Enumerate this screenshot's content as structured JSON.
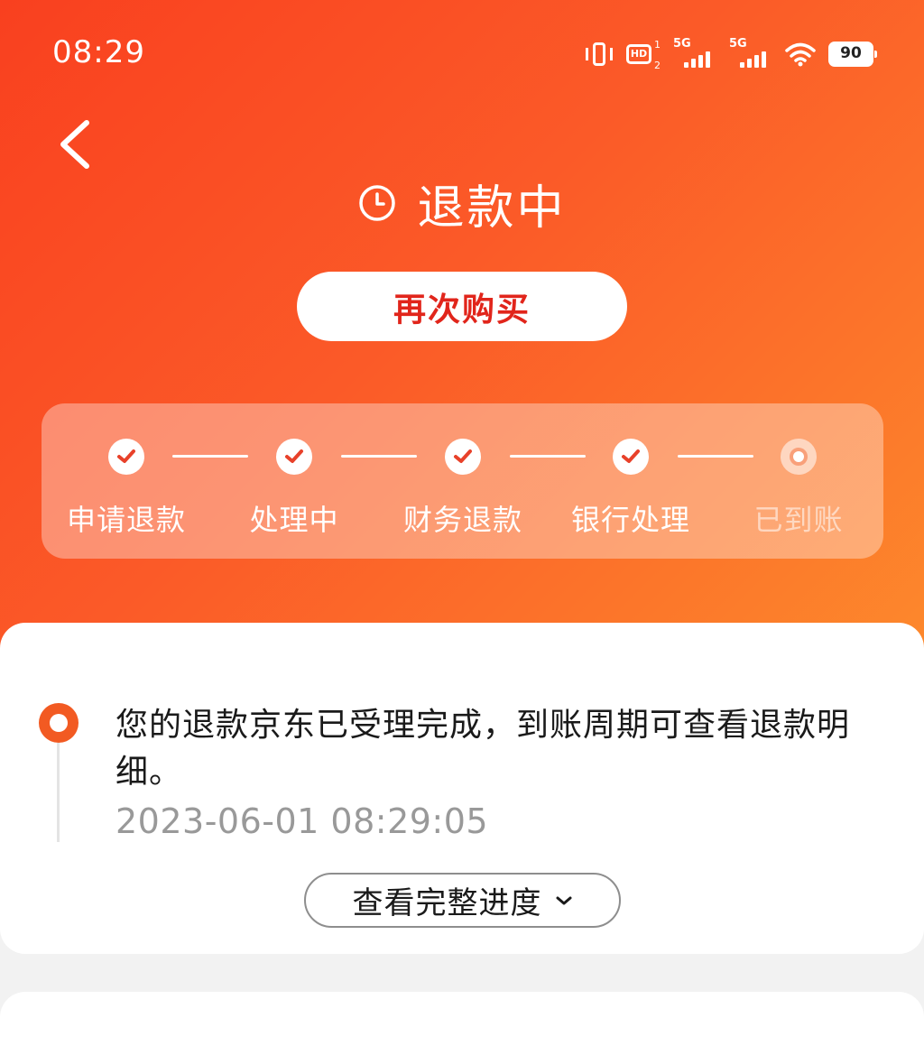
{
  "status_bar": {
    "time": "08:29",
    "hd_label": "HD",
    "hd_sup": "1",
    "hd_sub": "2",
    "sim1_label": "5G",
    "sim2_label": "5G",
    "battery": "90"
  },
  "header": {
    "status_title": "退款中",
    "rebuy_label": "再次购买"
  },
  "progress": {
    "steps": [
      {
        "label": "申请退款",
        "state": "done"
      },
      {
        "label": "处理中",
        "state": "done"
      },
      {
        "label": "财务退款",
        "state": "done"
      },
      {
        "label": "银行处理",
        "state": "done"
      },
      {
        "label": "已到账",
        "state": "pending"
      }
    ]
  },
  "detail": {
    "message": "您的退款京东已受理完成，到账周期可查看退款明细。",
    "timestamp": "2023-06-01 08:29:05",
    "view_all_label": "查看完整进度"
  },
  "colors": {
    "accent": "#e1251b",
    "gradient_start": "#f9401f",
    "gradient_end": "#fd8a2c",
    "timeline_dot": "#f25a22"
  }
}
